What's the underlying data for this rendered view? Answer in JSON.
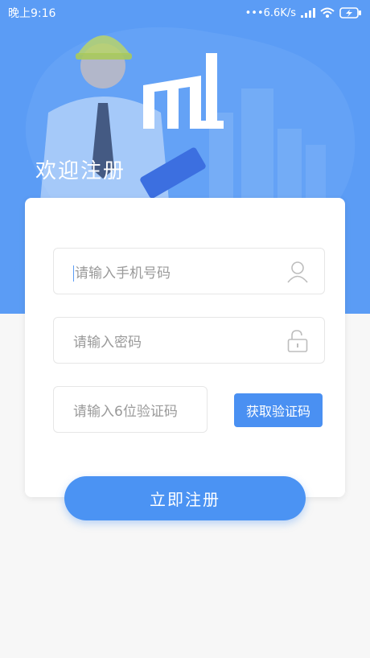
{
  "status_bar": {
    "time": "晚上9:16",
    "network_speed": "6.6K/s",
    "icons": [
      "signal-icon",
      "wifi-icon",
      "battery-charging-icon"
    ]
  },
  "hero": {
    "welcome_title": "欢迎注册",
    "logo": "ml-logo"
  },
  "form": {
    "phone_placeholder": "请输入手机号码",
    "password_placeholder": "请输入密码",
    "code_placeholder": "请输入6位验证码",
    "get_code_label": "获取验证码"
  },
  "actions": {
    "register_label": "立即注册"
  },
  "colors": {
    "primary": "#4b93f3",
    "hero_bg": "#5b9cf5"
  }
}
